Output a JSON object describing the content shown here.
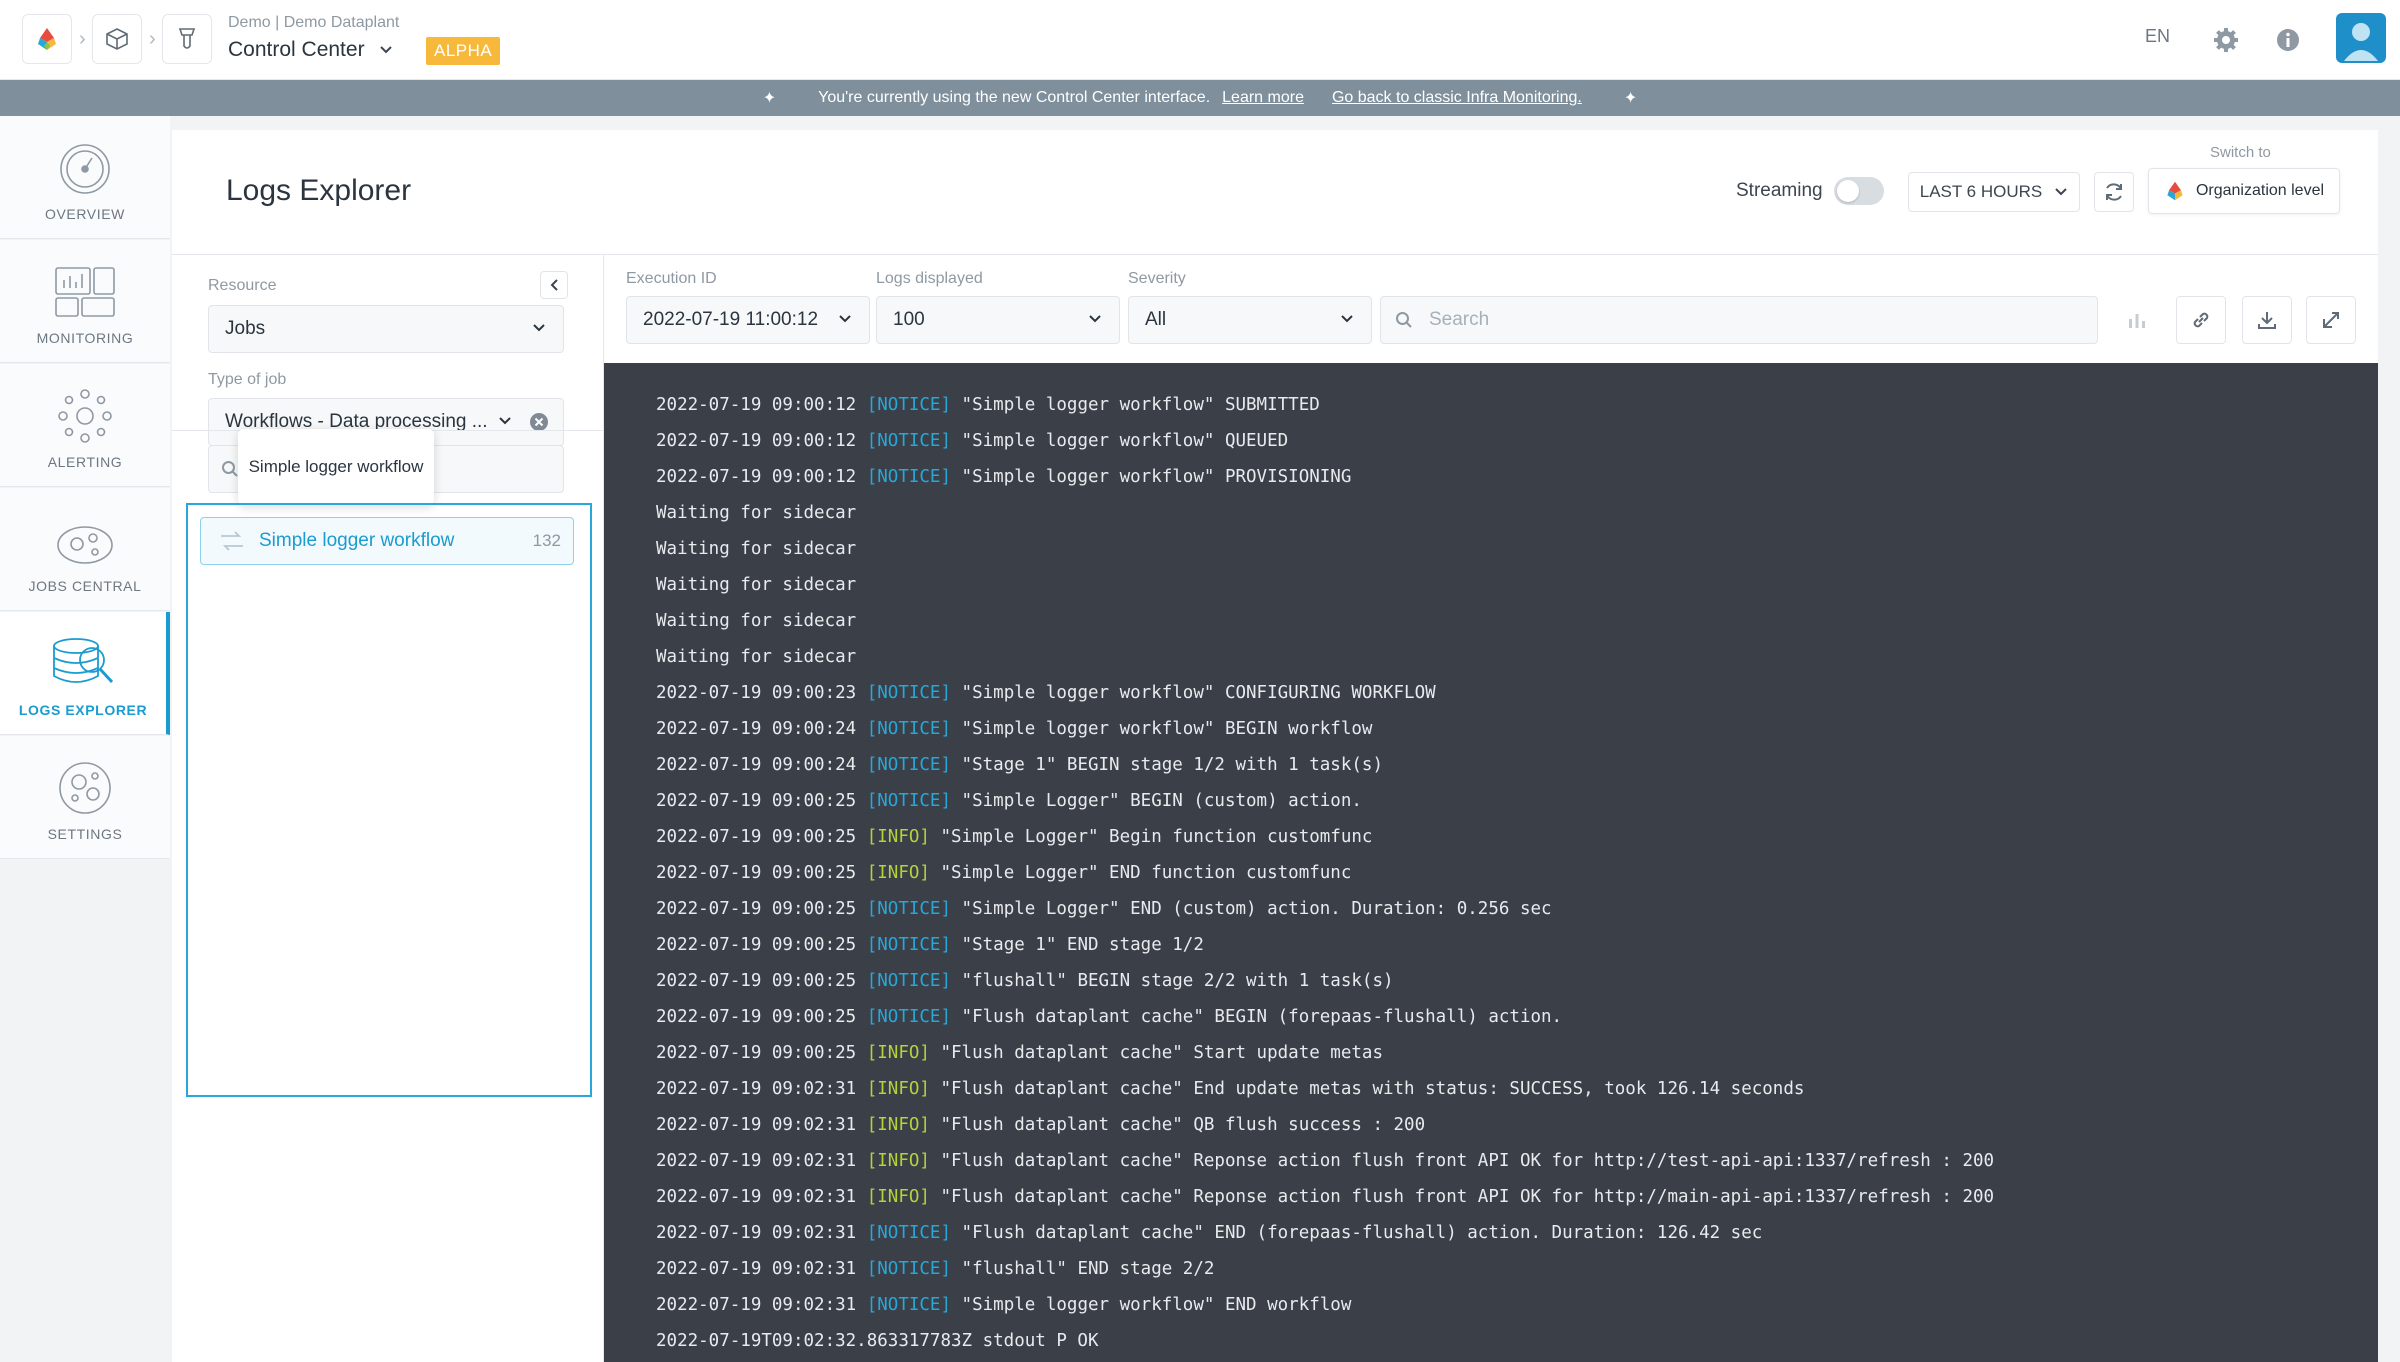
{
  "header": {
    "breadcrumb_sub": "Demo | Demo Dataplant",
    "app_name": "Control Center",
    "badge": "ALPHA",
    "language": "EN",
    "icons": [
      "logo-icon",
      "cube-icon",
      "flask-icon",
      "gear-icon",
      "info-icon",
      "user-icon"
    ]
  },
  "banner": {
    "text": "You're currently using the new Control Center interface.",
    "learn_more": "Learn more",
    "go_back": "Go back to classic Infra Monitoring."
  },
  "nav": {
    "items": [
      {
        "label": "OVERVIEW",
        "icon": "gauge-icon"
      },
      {
        "label": "MONITORING",
        "icon": "dashboard-icon"
      },
      {
        "label": "ALERTING",
        "icon": "alert-network-icon"
      },
      {
        "label": "JOBS CENTRAL",
        "icon": "jobs-icon"
      },
      {
        "label": "LOGS EXPLORER",
        "icon": "logs-search-icon",
        "active": true
      },
      {
        "label": "SETTINGS",
        "icon": "settings-icon"
      }
    ]
  },
  "page": {
    "title": "Logs Explorer",
    "streaming_label": "Streaming",
    "streaming_on": false,
    "time_range": "LAST 6 HOURS",
    "switch_to_label": "Switch to",
    "org_level": "Organization level"
  },
  "filters": {
    "resource_label": "Resource",
    "resource_value": "Jobs",
    "type_label": "Type of job",
    "type_value": "Workflows - Data processing ...",
    "tooltip": "Simple logger workflow",
    "list": [
      {
        "name": "Simple logger workflow",
        "count": "132"
      }
    ]
  },
  "toolbar": {
    "execution_label": "Execution ID",
    "execution_value": "2022-07-19 11:00:12",
    "logs_label": "Logs displayed",
    "logs_value": "100",
    "severity_label": "Severity",
    "severity_value": "All",
    "search_placeholder": "Search"
  },
  "colors": {
    "accent": "#1a9cd1",
    "alpha_badge": "#f6b93b",
    "banner": "#7f8f9c",
    "log_bg": "#3a3f48",
    "notice": "#29a7d8",
    "info": "#b4d23c"
  },
  "logs": [
    {
      "prefix": "2022-07-19 09:00:12 ",
      "level": "[NOTICE]",
      "lvl": "notice",
      "msg": " \"Simple logger workflow\" SUBMITTED"
    },
    {
      "prefix": "2022-07-19 09:00:12 ",
      "level": "[NOTICE]",
      "lvl": "notice",
      "msg": " \"Simple logger workflow\" QUEUED"
    },
    {
      "prefix": "2022-07-19 09:00:12 ",
      "level": "[NOTICE]",
      "lvl": "notice",
      "msg": " \"Simple logger workflow\" PROVISIONING"
    },
    {
      "prefix": "Waiting for sidecar",
      "level": "",
      "lvl": "",
      "msg": ""
    },
    {
      "prefix": "Waiting for sidecar",
      "level": "",
      "lvl": "",
      "msg": ""
    },
    {
      "prefix": "Waiting for sidecar",
      "level": "",
      "lvl": "",
      "msg": ""
    },
    {
      "prefix": "Waiting for sidecar",
      "level": "",
      "lvl": "",
      "msg": ""
    },
    {
      "prefix": "Waiting for sidecar",
      "level": "",
      "lvl": "",
      "msg": ""
    },
    {
      "prefix": "2022-07-19 09:00:23 ",
      "level": "[NOTICE]",
      "lvl": "notice",
      "msg": " \"Simple logger workflow\" CONFIGURING WORKFLOW"
    },
    {
      "prefix": "2022-07-19 09:00:24 ",
      "level": "[NOTICE]",
      "lvl": "notice",
      "msg": " \"Simple logger workflow\" BEGIN workflow"
    },
    {
      "prefix": "2022-07-19 09:00:24 ",
      "level": "[NOTICE]",
      "lvl": "notice",
      "msg": " \"Stage 1\" BEGIN stage 1/2 with 1 task(s)"
    },
    {
      "prefix": "2022-07-19 09:00:25 ",
      "level": "[NOTICE]",
      "lvl": "notice",
      "msg": " \"Simple Logger\" BEGIN (custom) action."
    },
    {
      "prefix": "2022-07-19 09:00:25 ",
      "level": "[INFO]",
      "lvl": "info",
      "msg": " \"Simple Logger\" Begin function customfunc"
    },
    {
      "prefix": "2022-07-19 09:00:25 ",
      "level": "[INFO]",
      "lvl": "info",
      "msg": " \"Simple Logger\" END function customfunc"
    },
    {
      "prefix": "2022-07-19 09:00:25 ",
      "level": "[NOTICE]",
      "lvl": "notice",
      "msg": " \"Simple Logger\" END (custom) action. Duration: 0.256 sec"
    },
    {
      "prefix": "2022-07-19 09:00:25 ",
      "level": "[NOTICE]",
      "lvl": "notice",
      "msg": " \"Stage 1\" END stage 1/2"
    },
    {
      "prefix": "2022-07-19 09:00:25 ",
      "level": "[NOTICE]",
      "lvl": "notice",
      "msg": " \"flushall\" BEGIN stage 2/2 with 1 task(s)"
    },
    {
      "prefix": "2022-07-19 09:00:25 ",
      "level": "[NOTICE]",
      "lvl": "notice",
      "msg": " \"Flush dataplant cache\" BEGIN (forepaas-flushall) action."
    },
    {
      "prefix": "2022-07-19 09:00:25 ",
      "level": "[INFO]",
      "lvl": "info",
      "msg": " \"Flush dataplant cache\" Start update metas"
    },
    {
      "prefix": "2022-07-19 09:02:31 ",
      "level": "[INFO]",
      "lvl": "info",
      "msg": " \"Flush dataplant cache\" End update metas with status: SUCCESS, took 126.14 seconds"
    },
    {
      "prefix": "2022-07-19 09:02:31 ",
      "level": "[INFO]",
      "lvl": "info",
      "msg": " \"Flush dataplant cache\" QB flush success : 200"
    },
    {
      "prefix": "2022-07-19 09:02:31 ",
      "level": "[INFO]",
      "lvl": "info",
      "msg": " \"Flush dataplant cache\" Reponse action flush front API OK for http://test-api-api:1337/refresh : 200"
    },
    {
      "prefix": "2022-07-19 09:02:31 ",
      "level": "[INFO]",
      "lvl": "info",
      "msg": " \"Flush dataplant cache\" Reponse action flush front API OK for http://main-api-api:1337/refresh : 200"
    },
    {
      "prefix": "2022-07-19 09:02:31 ",
      "level": "[NOTICE]",
      "lvl": "notice",
      "msg": " \"Flush dataplant cache\" END (forepaas-flushall) action. Duration: 126.42 sec"
    },
    {
      "prefix": "2022-07-19 09:02:31 ",
      "level": "[NOTICE]",
      "lvl": "notice",
      "msg": " \"flushall\" END stage 2/2"
    },
    {
      "prefix": "2022-07-19 09:02:31 ",
      "level": "[NOTICE]",
      "lvl": "notice",
      "msg": " \"Simple logger workflow\" END workflow"
    },
    {
      "prefix": "2022-07-19T09:02:32.863317783Z stdout P OK",
      "level": "",
      "lvl": "",
      "msg": ""
    }
  ]
}
